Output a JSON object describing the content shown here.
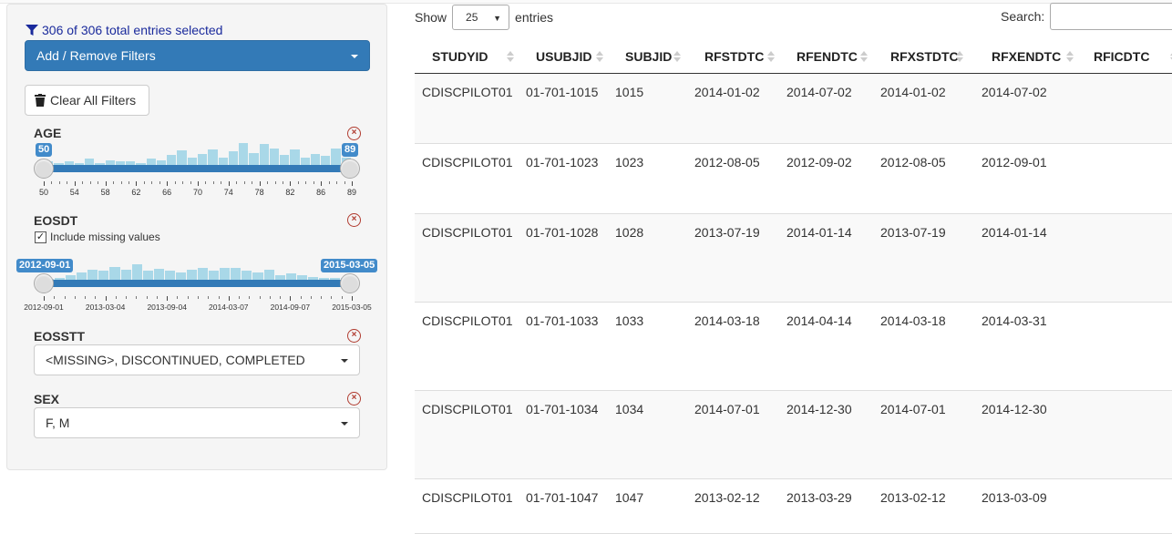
{
  "filter_panel": {
    "count_text": "306 of 306 total entries selected",
    "add_remove_label": "Add / Remove Filters",
    "clear_all_label": "Clear All Filters",
    "filters": {
      "age": {
        "label": "AGE",
        "min_value": "50",
        "max_value": "89",
        "ticks": [
          "50",
          "54",
          "58",
          "62",
          "66",
          "70",
          "74",
          "78",
          "82",
          "86",
          "89"
        ],
        "selected_range": [
          50,
          89
        ]
      },
      "eosdt": {
        "label": "EOSDT",
        "include_missing_label": "Include missing values",
        "include_missing_checked": true,
        "min_value": "2012-09-01",
        "max_value": "2015-03-05",
        "ticks": [
          "2012-09-01",
          "2013-03-04",
          "2013-09-04",
          "2014-03-07",
          "2014-09-07",
          "2015-03-05"
        ]
      },
      "eosstt": {
        "label": "EOSSTT",
        "value": "<MISSING>, DISCONTINUED, COMPLETED"
      },
      "sex": {
        "label": "SEX",
        "value": "F, M"
      }
    }
  },
  "table": {
    "show_label": "Show",
    "page_length": "25",
    "entries_label": "entries",
    "search_label": "Search:",
    "search_value": "",
    "columns": [
      "STUDYID",
      "USUBJID",
      "SUBJID",
      "RFSTDTC",
      "RFENDTC",
      "RFXSTDTC",
      "RFXENDTC",
      "RFICDTC"
    ],
    "rows": [
      [
        "CDISCPILOT01",
        "01-701-1015",
        "1015",
        "2014-01-02",
        "2014-07-02",
        "2014-01-02",
        "2014-07-02",
        ""
      ],
      [
        "CDISCPILOT01",
        "01-701-1023",
        "1023",
        "2012-08-05",
        "2012-09-02",
        "2012-08-05",
        "2012-09-01",
        ""
      ],
      [
        "CDISCPILOT01",
        "01-701-1028",
        "1028",
        "2013-07-19",
        "2014-01-14",
        "2013-07-19",
        "2014-01-14",
        ""
      ],
      [
        "CDISCPILOT01",
        "01-701-1033",
        "1033",
        "2014-03-18",
        "2014-04-14",
        "2014-03-18",
        "2014-03-31",
        ""
      ],
      [
        "CDISCPILOT01",
        "01-701-1034",
        "1034",
        "2014-07-01",
        "2014-12-30",
        "2014-07-01",
        "2014-12-30",
        ""
      ],
      [
        "CDISCPILOT01",
        "01-701-1047",
        "1047",
        "2013-02-12",
        "2013-03-29",
        "2013-02-12",
        "2013-03-09",
        ""
      ]
    ]
  },
  "colors": {
    "primary": "#337ab7",
    "histogram": "#a9d8e8",
    "close_icon": "#b03a2e",
    "count_text": "#1a2a9c"
  }
}
